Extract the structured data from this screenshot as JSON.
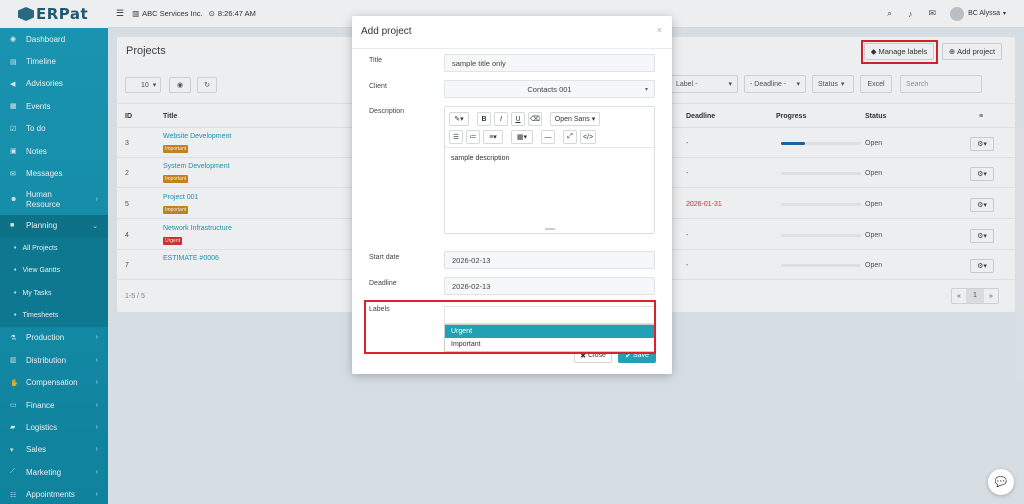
{
  "app": {
    "logo": "ERPat"
  },
  "topbar": {
    "company": "ABC Services Inc.",
    "time": "8:26:47 AM",
    "user": "BC Alyssa"
  },
  "sidebar": {
    "items": [
      {
        "label": "Dashboard",
        "icon": "dashboard-icon"
      },
      {
        "label": "Timeline",
        "icon": "timeline-icon"
      },
      {
        "label": "Advisories",
        "icon": "megaphone-icon"
      },
      {
        "label": "Events",
        "icon": "calendar-icon"
      },
      {
        "label": "To do",
        "icon": "checkbox-icon"
      },
      {
        "label": "Notes",
        "icon": "note-icon"
      },
      {
        "label": "Messages",
        "icon": "envelope-icon"
      },
      {
        "label": "Human Resource",
        "icon": "people-icon"
      },
      {
        "label": "Planning",
        "icon": "briefcase-icon"
      }
    ],
    "sub_items": [
      "All Projects",
      "View Gantts",
      "My Tasks",
      "Timesheets"
    ],
    "more_items": [
      {
        "label": "Production",
        "icon": "flask-icon"
      },
      {
        "label": "Distribution",
        "icon": "bank-icon"
      },
      {
        "label": "Compensation",
        "icon": "money-icon"
      },
      {
        "label": "Finance",
        "icon": "finance-icon"
      },
      {
        "label": "Logistics",
        "icon": "truck-icon"
      },
      {
        "label": "Sales",
        "icon": "cart-icon"
      },
      {
        "label": "Marketing",
        "icon": "chart-icon"
      },
      {
        "label": "Appointments",
        "icon": "appointment-icon"
      }
    ]
  },
  "page": {
    "title": "Projects",
    "manage_labels": "Manage labels",
    "add_project": "Add project",
    "page_size": "10",
    "filters": {
      "label": "Label -",
      "deadline": "- Deadline -",
      "status": "Status"
    },
    "excel": "Excel",
    "search_placeholder": "Search",
    "columns": [
      "ID",
      "Title",
      "Deadline",
      "Progress",
      "Status"
    ],
    "rows": [
      {
        "id": "3",
        "title": "Website Development",
        "label": "Important",
        "label_color": "#d2891b",
        "deadline": "-",
        "progress": 0.3,
        "status": "Open"
      },
      {
        "id": "2",
        "title": "System Development",
        "label": "Important",
        "label_color": "#d2891b",
        "deadline": "-",
        "progress": 0,
        "status": "Open"
      },
      {
        "id": "5",
        "title": "Project 001",
        "label": "Important",
        "label_color": "#d2891b",
        "deadline": "2026-01-31",
        "progress": 0,
        "status": "Open"
      },
      {
        "id": "4",
        "title": "Network Infrastructure",
        "label": "Urgent",
        "label_color": "#d9322e",
        "deadline": "-",
        "progress": 0,
        "status": "Open"
      },
      {
        "id": "7",
        "title": "ESTIMATE #0006",
        "label": "",
        "label_color": "",
        "deadline": "-",
        "progress": 0,
        "status": "Open"
      }
    ],
    "pagination_info": "1-5 / 5",
    "current_page": "1"
  },
  "modal": {
    "title": "Add project",
    "fields": {
      "title_label": "Title",
      "title_value": "sample title only",
      "client_label": "Client",
      "client_value": "Contacts 001",
      "description_label": "Description",
      "description_value": "sample description",
      "font": "Open Sans",
      "start_label": "Start date",
      "start_value": "2026-02-13",
      "deadline_label": "Deadline",
      "deadline_value": "2026-02-13",
      "labels_label": "Labels"
    },
    "label_options": [
      "Urgent",
      "Important"
    ],
    "close": "Close",
    "save": "Save"
  }
}
